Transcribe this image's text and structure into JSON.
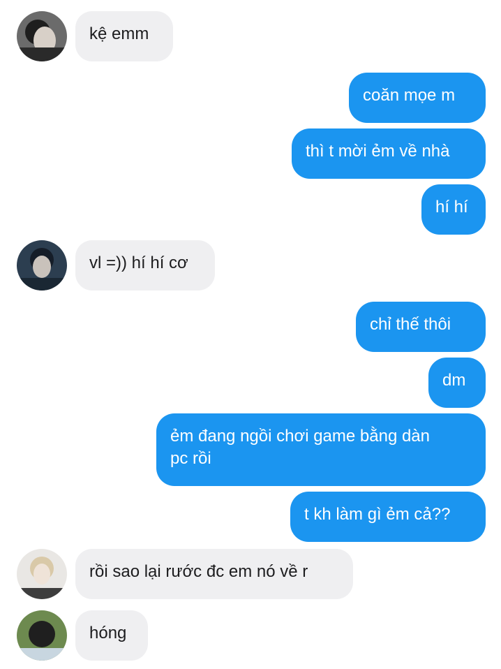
{
  "conversation": {
    "messages": [
      {
        "id": "m1",
        "direction": "incoming",
        "text": "kệ emm",
        "avatar": "avatar-a"
      },
      {
        "id": "m2",
        "direction": "outgoing",
        "text": "coăn mọe m"
      },
      {
        "id": "m3",
        "direction": "outgoing",
        "text": "thì t mời ẻm về nhà"
      },
      {
        "id": "m4",
        "direction": "outgoing",
        "text": "hí hí"
      },
      {
        "id": "m5",
        "direction": "incoming",
        "text": "vl =)) hí hí cơ",
        "avatar": "avatar-b"
      },
      {
        "id": "m6",
        "direction": "outgoing",
        "text": "chỉ thế thôi"
      },
      {
        "id": "m7",
        "direction": "outgoing",
        "text": "dm"
      },
      {
        "id": "m8",
        "direction": "outgoing",
        "text": "ẻm đang ngồi chơi game bằng dàn\npc rồi"
      },
      {
        "id": "m9",
        "direction": "outgoing",
        "text": "t kh làm gì ẻm cả??"
      },
      {
        "id": "m10",
        "direction": "incoming",
        "text": "rồi sao lại rước đc em nó về r",
        "avatar": "avatar-c"
      },
      {
        "id": "m11",
        "direction": "incoming",
        "text": "hóng",
        "avatar": "avatar-d"
      }
    ]
  },
  "colors": {
    "outgoing_bubble": "#1b95f0",
    "incoming_bubble": "#efeff1",
    "outgoing_text": "#ffffff",
    "incoming_text": "#1c1c1e",
    "background": "#ffffff"
  }
}
